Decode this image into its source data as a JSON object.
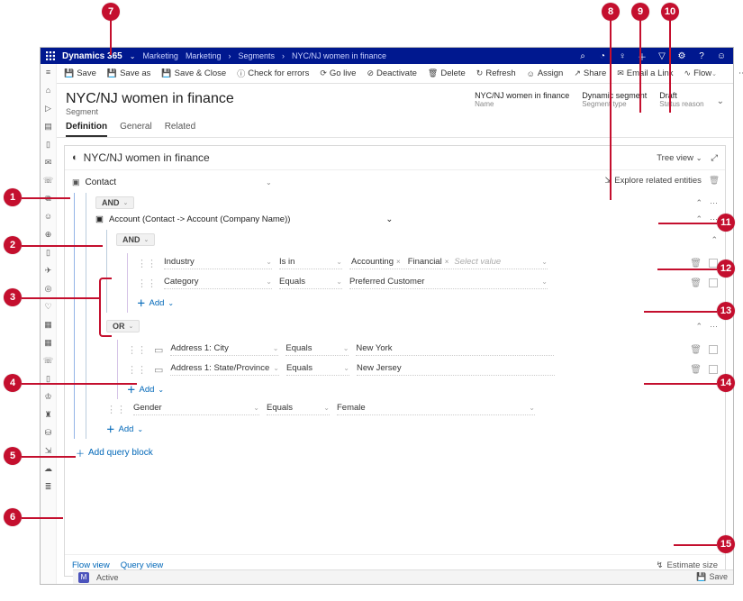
{
  "header": {
    "brand": "Dynamics 365",
    "area": "Marketing",
    "breadcrumbs": [
      "Marketing",
      "Segments",
      "NYC/NJ women in finance"
    ]
  },
  "commands": {
    "save": "Save",
    "save_as": "Save as",
    "save_close": "Save & Close",
    "check_errors": "Check for errors",
    "go_live": "Go live",
    "deactivate": "Deactivate",
    "delete": "Delete",
    "refresh": "Refresh",
    "assign": "Assign",
    "share": "Share",
    "email_link": "Email a Link",
    "flow": "Flow",
    "more": "⋯"
  },
  "record": {
    "title": "NYC/NJ women in finance",
    "entity": "Segment",
    "fields": {
      "name": {
        "label": "Name",
        "value": "NYC/NJ women in finance"
      },
      "type": {
        "label": "Segment type",
        "value": "Dynamic segment"
      },
      "status": {
        "label": "Status reason",
        "value": "Draft"
      }
    }
  },
  "tabs": [
    "Definition",
    "General",
    "Related"
  ],
  "designer": {
    "title": "NYC/NJ women in finance",
    "view_mode": "Tree view",
    "explore": "Explore related entities",
    "root_entity": "Contact",
    "group1_op": "AND",
    "sub_entity": "Account (Contact -> Account (Company Name))",
    "group2_op": "AND",
    "clauses_g2": [
      {
        "field": "Industry",
        "operator": "Is in",
        "values": [
          "Accounting",
          "Financial"
        ],
        "placeholder": "Select value"
      },
      {
        "field": "Category",
        "operator": "Equals",
        "value": "Preferred Customer"
      }
    ],
    "group3_op": "OR",
    "clauses_g3": [
      {
        "field": "Address 1: City",
        "operator": "Equals",
        "value": "New York"
      },
      {
        "field": "Address 1: State/Province",
        "operator": "Equals",
        "value": "New Jersey"
      }
    ],
    "clause_gender": {
      "field": "Gender",
      "operator": "Equals",
      "value": "Female"
    },
    "add_label": "Add",
    "add_block": "Add query block",
    "views": [
      "Flow view",
      "Query view"
    ],
    "estimate": "Estimate size"
  },
  "status_bar": {
    "badge": "M",
    "state": "Active",
    "save": "Save"
  },
  "callouts": [
    "1",
    "2",
    "3",
    "4",
    "5",
    "6",
    "7",
    "8",
    "9",
    "10",
    "11",
    "12",
    "13",
    "14",
    "15"
  ]
}
